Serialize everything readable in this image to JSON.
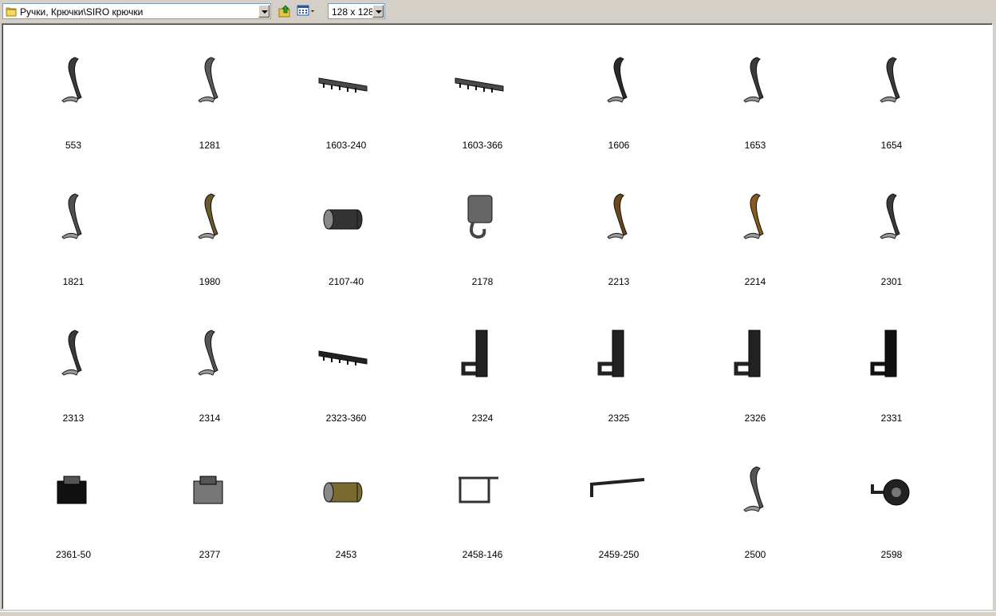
{
  "toolbar": {
    "path": "Ручки, Крючки\\SIRO крючки",
    "icons": [
      "folder-icon",
      "up-folder-icon",
      "view-mode-icon"
    ],
    "thumb_size": "128 x 128"
  },
  "items": [
    {
      "label": "553",
      "icon": "hook-icon",
      "color": "#3a3a3a"
    },
    {
      "label": "1281",
      "icon": "hook-icon",
      "color": "#5a5a5a"
    },
    {
      "label": "1603-240",
      "icon": "rail-hook-icon",
      "color": "#4a4a4a"
    },
    {
      "label": "1603-366",
      "icon": "rail-hook-icon",
      "color": "#4a4a4a"
    },
    {
      "label": "1606",
      "icon": "hook-icon",
      "color": "#2a2a2a"
    },
    {
      "label": "1653",
      "icon": "hook-icon",
      "color": "#3a3a3a"
    },
    {
      "label": "1654",
      "icon": "hook-icon",
      "color": "#3a3a3a"
    },
    {
      "label": "1821",
      "icon": "hook-icon",
      "color": "#505050"
    },
    {
      "label": "1980",
      "icon": "hook-icon",
      "color": "#6b5a2a"
    },
    {
      "label": "2107-40",
      "icon": "cylinder-hook-icon",
      "color": "#333333"
    },
    {
      "label": "2178",
      "icon": "square-hook-icon",
      "color": "#666666"
    },
    {
      "label": "2213",
      "icon": "hook-icon",
      "color": "#6b4a1a"
    },
    {
      "label": "2214",
      "icon": "hook-icon",
      "color": "#8a5a1a"
    },
    {
      "label": "2301",
      "icon": "hook-icon",
      "color": "#3a3a3a"
    },
    {
      "label": "2313",
      "icon": "hook-icon",
      "color": "#3a3a3a"
    },
    {
      "label": "2314",
      "icon": "hook-icon",
      "color": "#555555"
    },
    {
      "label": "2323-360",
      "icon": "rail-hook-icon",
      "color": "#222222"
    },
    {
      "label": "2324",
      "icon": "bracket-hook-icon",
      "color": "#222222"
    },
    {
      "label": "2325",
      "icon": "bracket-hook-icon",
      "color": "#222222"
    },
    {
      "label": "2326",
      "icon": "bracket-hook-icon",
      "color": "#222222"
    },
    {
      "label": "2331",
      "icon": "bracket-hook-icon",
      "color": "#111111"
    },
    {
      "label": "2361-50",
      "icon": "clip-hook-icon",
      "color": "#111111"
    },
    {
      "label": "2377",
      "icon": "clip-hook-icon",
      "color": "#777777"
    },
    {
      "label": "2453",
      "icon": "cylinder-hook-icon",
      "color": "#7a6a30"
    },
    {
      "label": "2458-146",
      "icon": "towel-rail-icon",
      "color": "#333333"
    },
    {
      "label": "2459-250",
      "icon": "rod-icon",
      "color": "#222222"
    },
    {
      "label": "2500",
      "icon": "hook-icon",
      "color": "#555555"
    },
    {
      "label": "2598",
      "icon": "round-hook-icon",
      "color": "#222222"
    }
  ]
}
